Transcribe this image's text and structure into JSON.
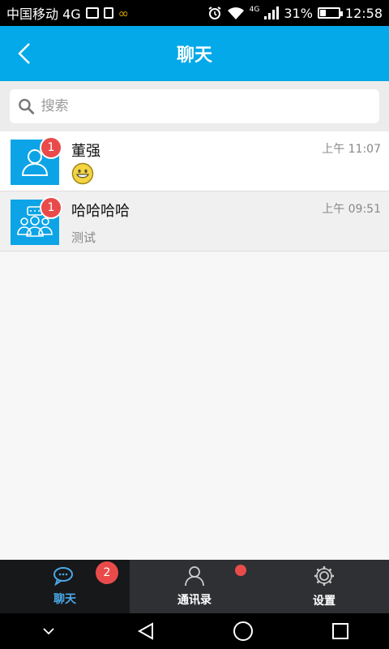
{
  "status_bar": {
    "carrier": "中国移动 4G",
    "network_badge": "4G",
    "battery_percent": "31%",
    "battery_level": 0.31,
    "time": "12:58"
  },
  "header": {
    "title": "聊天",
    "back_icon": "chevron-left-icon"
  },
  "search": {
    "placeholder": "搜索",
    "value": ""
  },
  "chats": [
    {
      "name": "董强",
      "time": "上午 11:07",
      "unread": "1",
      "preview": "",
      "preview_icon": "smiley-emoji-icon",
      "avatar_icon": "person-icon"
    },
    {
      "name": "哈哈哈哈",
      "time": "上午 09:51",
      "unread": "1",
      "preview": "测试",
      "avatar_icon": "group-icon"
    }
  ],
  "tabs": [
    {
      "label": "聊天",
      "icon": "chat-icon",
      "badge": "2",
      "active": true
    },
    {
      "label": "通讯录",
      "icon": "contacts-icon",
      "dot": true
    },
    {
      "label": "设置",
      "icon": "gear-icon"
    }
  ],
  "colors": {
    "primary": "#03a9e8",
    "badge": "#e94b4b",
    "tab_active": "#4aa8e8"
  }
}
